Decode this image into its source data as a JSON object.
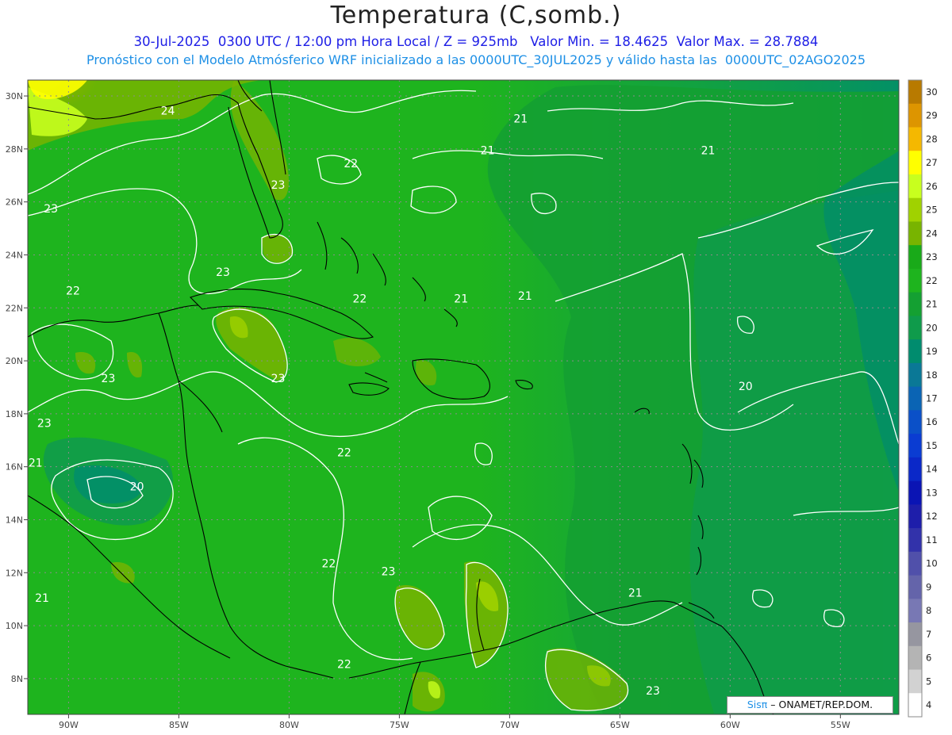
{
  "header": {
    "title": "Temperatura (C,somb.)",
    "subtitle_line1": "30-Jul-2025  0300 UTC / 12:00 pm Hora Local / Z = 925mb   Valor Min. = 18.4625  Valor Max. = 28.7884",
    "subtitle_line2": "Pronóstico con el Modelo Atmósferico WRF inicializado a las 0000UTC_30JUL2025 y válido hasta las  0000UTC_02AGO2025"
  },
  "map": {
    "lon_ticks": [
      "90W",
      "85W",
      "80W",
      "75W",
      "70W",
      "65W",
      "60W",
      "55W"
    ],
    "lat_ticks": [
      "30N",
      "28N",
      "26N",
      "24N",
      "22N",
      "20N",
      "18N",
      "16N",
      "14N",
      "12N",
      "10N",
      "8N"
    ],
    "contour_labels": [
      {
        "text": "24",
        "lon": -85.5,
        "lat": 29.3
      },
      {
        "text": "23",
        "lon": -80.5,
        "lat": 26.5
      },
      {
        "text": "22",
        "lon": -77.2,
        "lat": 27.3
      },
      {
        "text": "23",
        "lon": -90.8,
        "lat": 25.6
      },
      {
        "text": "21",
        "lon": -71.0,
        "lat": 27.8
      },
      {
        "text": "21",
        "lon": -69.5,
        "lat": 29.0
      },
      {
        "text": "21",
        "lon": -61.0,
        "lat": 27.8
      },
      {
        "text": "23",
        "lon": -83.0,
        "lat": 23.2
      },
      {
        "text": "22",
        "lon": -89.8,
        "lat": 22.5
      },
      {
        "text": "22",
        "lon": -76.8,
        "lat": 22.2
      },
      {
        "text": "21",
        "lon": -72.2,
        "lat": 22.2
      },
      {
        "text": "21",
        "lon": -69.3,
        "lat": 22.3
      },
      {
        "text": "23",
        "lon": -88.2,
        "lat": 19.2
      },
      {
        "text": "23",
        "lon": -80.5,
        "lat": 19.2
      },
      {
        "text": "20",
        "lon": -59.3,
        "lat": 18.9
      },
      {
        "text": "23",
        "lon": -91.1,
        "lat": 17.5
      },
      {
        "text": "21",
        "lon": -91.5,
        "lat": 16.0
      },
      {
        "text": "22",
        "lon": -77.5,
        "lat": 16.4
      },
      {
        "text": "20",
        "lon": -86.9,
        "lat": 15.1
      },
      {
        "text": "22",
        "lon": -78.2,
        "lat": 12.2
      },
      {
        "text": "23",
        "lon": -75.5,
        "lat": 11.9
      },
      {
        "text": "21",
        "lon": -64.3,
        "lat": 11.1
      },
      {
        "text": "21",
        "lon": -91.2,
        "lat": 10.9
      },
      {
        "text": "22",
        "lon": -77.5,
        "lat": 8.4
      },
      {
        "text": "23",
        "lon": -63.5,
        "lat": 7.4
      }
    ]
  },
  "colorbar": {
    "labels": [
      "30",
      "29",
      "28",
      "27",
      "26",
      "25",
      "24",
      "23",
      "22",
      "21",
      "20",
      "19",
      "18",
      "17",
      "16",
      "15",
      "14",
      "13",
      "12",
      "11",
      "10",
      "9",
      "8",
      "7",
      "6",
      "5",
      "4"
    ],
    "colors": [
      "#b87a00",
      "#dd9500",
      "#f5b800",
      "#ffff00",
      "#c8ff1e",
      "#a0d200",
      "#78b400",
      "#19aa19",
      "#1eb41e",
      "#14a032",
      "#0f9b4b",
      "#008c6e",
      "#0a7896",
      "#0a64b4",
      "#0a50c8",
      "#0a3cd2",
      "#0a28c8",
      "#0a14b4",
      "#1e1eaa",
      "#3232aa",
      "#5050aa",
      "#6464aa",
      "#7878b4",
      "#9696a0",
      "#b4b4b4",
      "#d2d2d2",
      "#ffffff"
    ]
  },
  "credit": {
    "sis": "Sisπ",
    "text": "– ONAMET/REP.DOM."
  }
}
